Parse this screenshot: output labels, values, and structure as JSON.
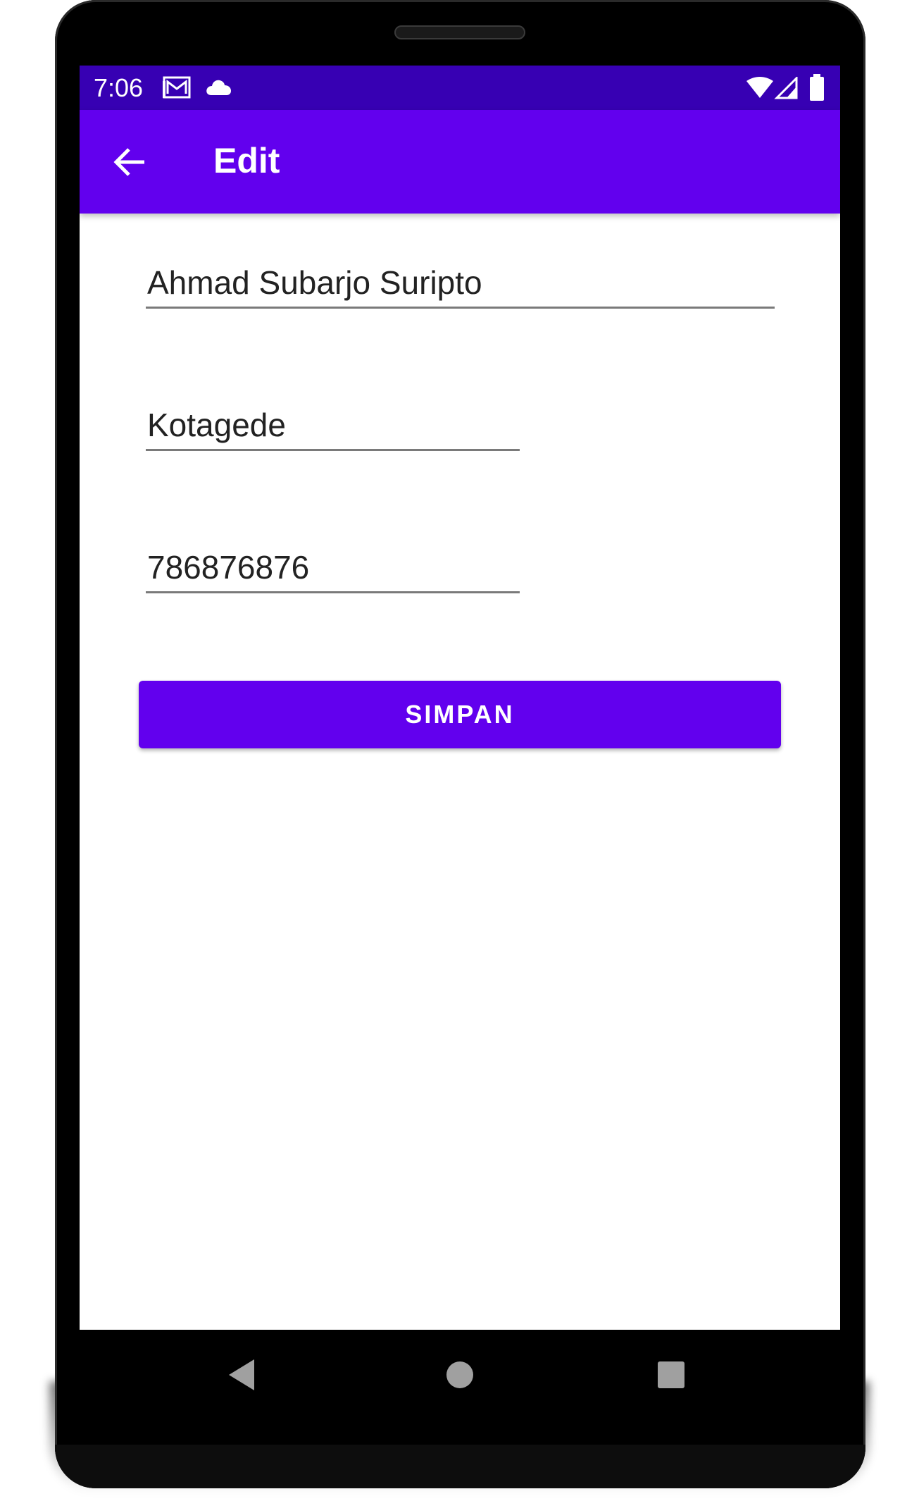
{
  "status_bar": {
    "time": "7:06",
    "icons": [
      "gmail-icon",
      "cloud-icon",
      "wifi-icon",
      "signal-icon",
      "battery-icon"
    ]
  },
  "app_bar": {
    "title": "Edit",
    "back_icon": "arrow-back-icon"
  },
  "form": {
    "name_value": "Ahmad Subarjo Suripto",
    "address_value": "Kotagede",
    "phone_value": "786876876"
  },
  "save_button": {
    "label": "SIMPAN"
  },
  "nav_bar": {
    "icons": [
      "back-triangle-icon",
      "home-circle-icon",
      "recents-square-icon"
    ]
  },
  "colors": {
    "primary": "#6200ee",
    "primary_dark": "#3700b3",
    "nav_icon": "#a0a0a0"
  }
}
